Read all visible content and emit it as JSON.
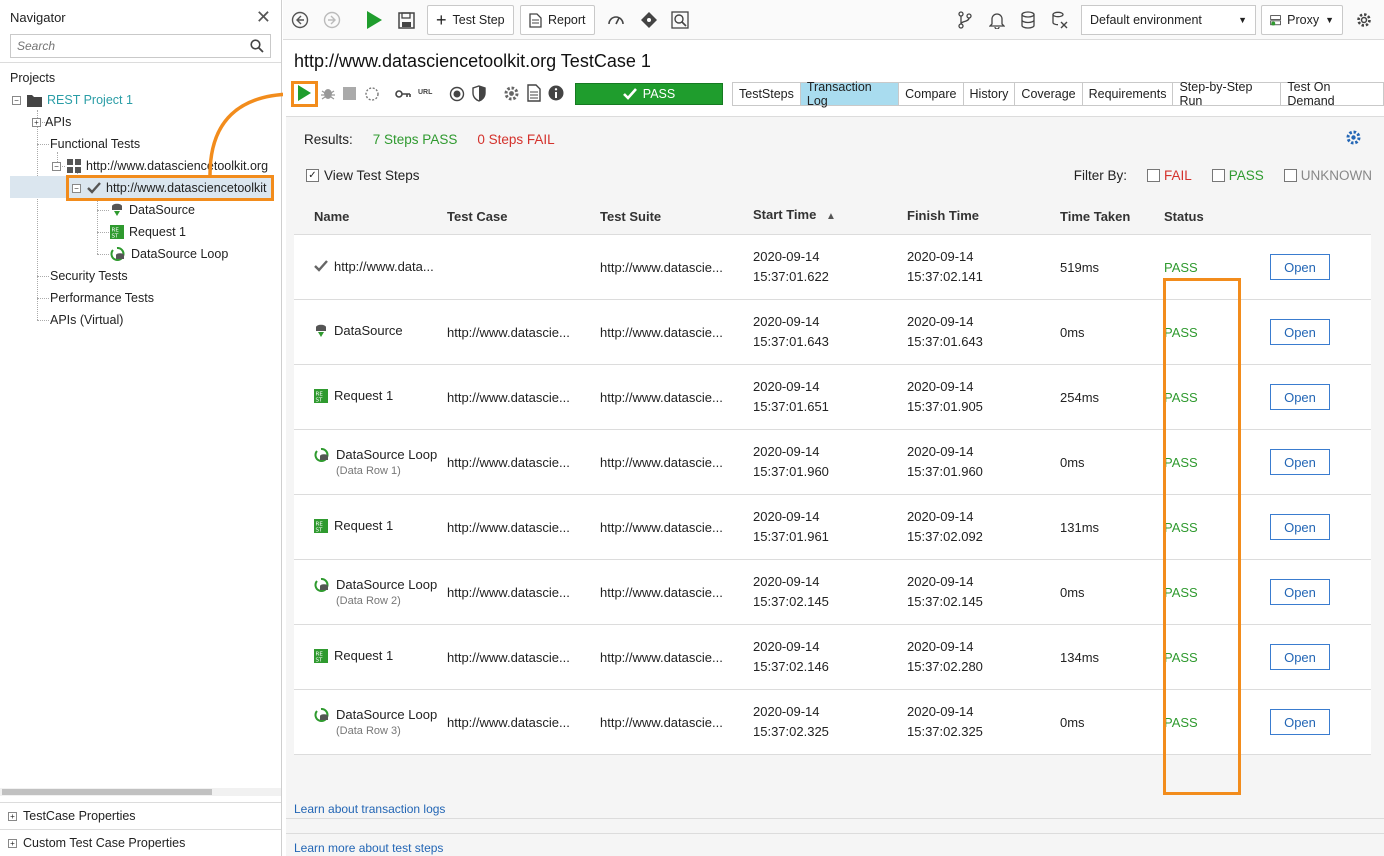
{
  "navigator": {
    "title": "Navigator",
    "search_placeholder": "Search",
    "projects_label": "Projects",
    "tree": {
      "project": "REST Project 1",
      "apis": "APIs",
      "functional_tests": "Functional Tests",
      "suite": "http://www.datasciencetoolkit.org",
      "testcase": "http://www.datasciencetoolkit",
      "datasource": "DataSource",
      "request": "Request 1",
      "datasource_loop": "DataSource Loop",
      "security_tests": "Security Tests",
      "performance_tests": "Performance Tests",
      "apis_virtual": "APIs (Virtual)"
    },
    "properties": {
      "testcase_properties": "TestCase Properties",
      "custom_properties": "Custom Test Case Properties"
    }
  },
  "toolbar": {
    "test_step_label": "Test Step",
    "report_label": "Report",
    "environment": "Default environment",
    "proxy_label": "Proxy"
  },
  "testcase": {
    "title": "http://www.datasciencetoolkit.org TestCase 1",
    "status_bar": "PASS",
    "url_label": "URL",
    "tabs": [
      "TestSteps",
      "Transaction Log",
      "Compare",
      "History",
      "Coverage",
      "Requirements",
      "Step-by-Step Run",
      "Test On Demand"
    ]
  },
  "results": {
    "label": "Results:",
    "pass_text": "7 Steps PASS",
    "fail_text": "0 Steps FAIL",
    "view_test_steps": "View Test Steps",
    "filter_by": "Filter By:",
    "filter_fail": "FAIL",
    "filter_pass": "PASS",
    "filter_unknown": "UNKNOWN"
  },
  "table": {
    "columns": [
      "Name",
      "Test Case",
      "Test Suite",
      "Start Time",
      "Finish Time",
      "Time Taken",
      "Status"
    ],
    "open_label": "Open",
    "rows": [
      {
        "icon": "check-icon",
        "name": "http://www.data...",
        "sub": "",
        "case": "",
        "suite": "http://www.datascie...",
        "start_date": "2020-09-14",
        "start_time": "15:37:01.622",
        "finish_date": "2020-09-14",
        "finish_time": "15:37:02.141",
        "taken": "519ms",
        "status": "PASS"
      },
      {
        "icon": "datasource-icon",
        "name": "DataSource",
        "sub": "",
        "case": "http://www.datascie...",
        "suite": "http://www.datascie...",
        "start_date": "2020-09-14",
        "start_time": "15:37:01.643",
        "finish_date": "2020-09-14",
        "finish_time": "15:37:01.643",
        "taken": "0ms",
        "status": "PASS"
      },
      {
        "icon": "rest-request-icon",
        "name": "Request 1",
        "sub": "",
        "case": "http://www.datascie...",
        "suite": "http://www.datascie...",
        "start_date": "2020-09-14",
        "start_time": "15:37:01.651",
        "finish_date": "2020-09-14",
        "finish_time": "15:37:01.905",
        "taken": "254ms",
        "status": "PASS"
      },
      {
        "icon": "datasource-loop-icon",
        "name": "DataSource Loop",
        "sub": "(Data Row 1)",
        "case": "http://www.datascie...",
        "suite": "http://www.datascie...",
        "start_date": "2020-09-14",
        "start_time": "15:37:01.960",
        "finish_date": "2020-09-14",
        "finish_time": "15:37:01.960",
        "taken": "0ms",
        "status": "PASS"
      },
      {
        "icon": "rest-request-icon",
        "name": "Request 1",
        "sub": "",
        "case": "http://www.datascie...",
        "suite": "http://www.datascie...",
        "start_date": "2020-09-14",
        "start_time": "15:37:01.961",
        "finish_date": "2020-09-14",
        "finish_time": "15:37:02.092",
        "taken": "131ms",
        "status": "PASS"
      },
      {
        "icon": "datasource-loop-icon",
        "name": "DataSource Loop",
        "sub": "(Data Row 2)",
        "case": "http://www.datascie...",
        "suite": "http://www.datascie...",
        "start_date": "2020-09-14",
        "start_time": "15:37:02.145",
        "finish_date": "2020-09-14",
        "finish_time": "15:37:02.145",
        "taken": "0ms",
        "status": "PASS"
      },
      {
        "icon": "rest-request-icon",
        "name": "Request 1",
        "sub": "",
        "case": "http://www.datascie...",
        "suite": "http://www.datascie...",
        "start_date": "2020-09-14",
        "start_time": "15:37:02.146",
        "finish_date": "2020-09-14",
        "finish_time": "15:37:02.280",
        "taken": "134ms",
        "status": "PASS"
      },
      {
        "icon": "datasource-loop-icon",
        "name": "DataSource Loop",
        "sub": "(Data Row 3)",
        "case": "http://www.datascie...",
        "suite": "http://www.datascie...",
        "start_date": "2020-09-14",
        "start_time": "15:37:02.325",
        "finish_date": "2020-09-14",
        "finish_time": "15:37:02.325",
        "taken": "0ms",
        "status": "PASS"
      }
    ]
  },
  "links": {
    "learn_transaction_logs": "Learn about transaction logs",
    "learn_test_steps": "Learn more about test steps"
  },
  "colors": {
    "accent_teal": "#2a9da6",
    "pass_green": "#2f9a2f",
    "fail_red": "#d4322c",
    "highlight_orange": "#f28c1c",
    "active_tab": "#a9dcef"
  }
}
